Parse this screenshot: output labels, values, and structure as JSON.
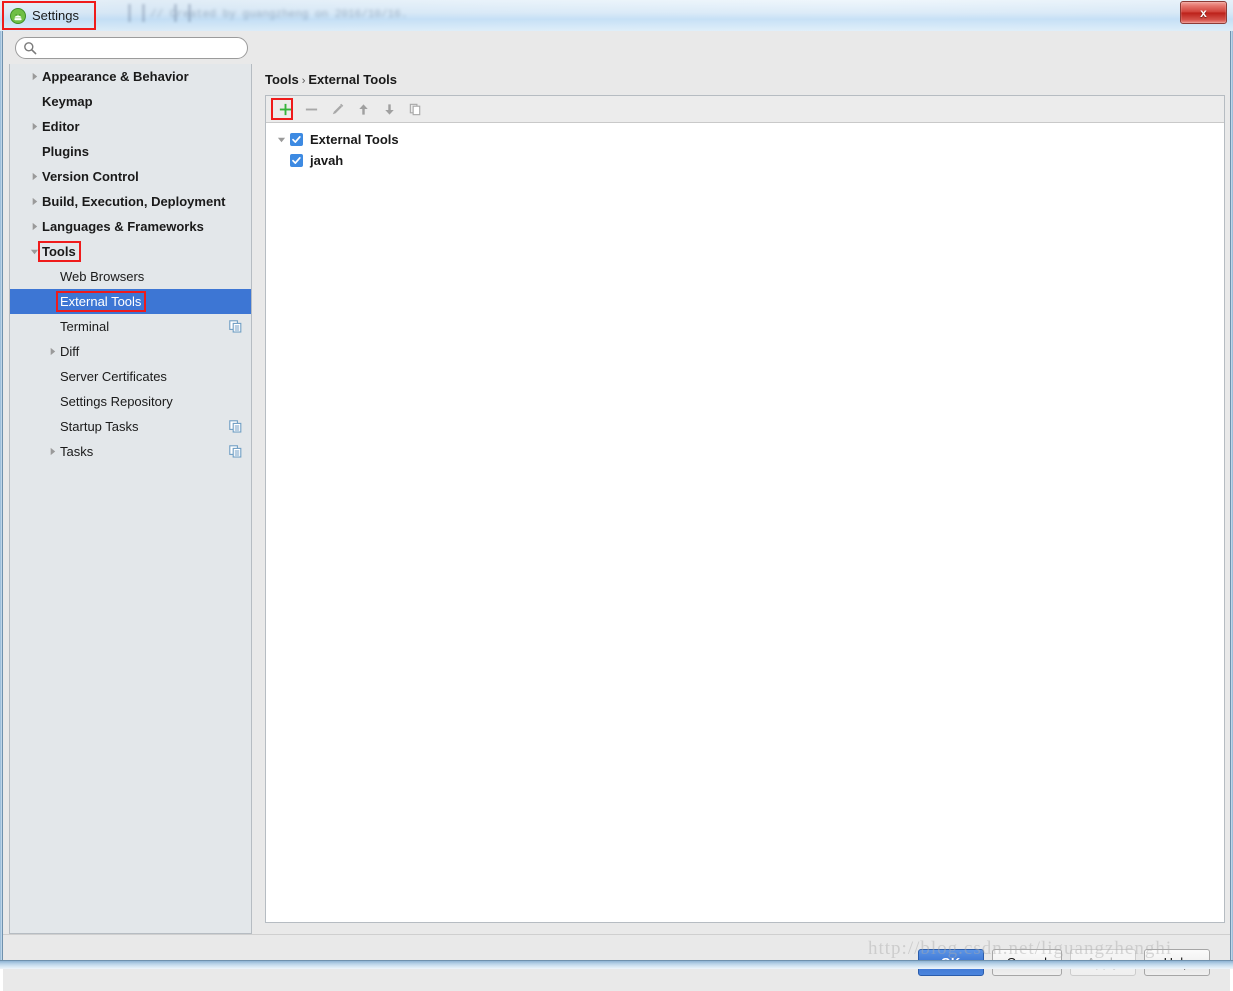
{
  "window": {
    "title": "Settings",
    "title_icon": "android-settings-icon",
    "close_label": "x",
    "glass_ghost_text": "// Created by guangzheng on 2016/10/16."
  },
  "search": {
    "value": "",
    "placeholder": "",
    "icon": "search-icon"
  },
  "sidebar": {
    "items": [
      {
        "label": "Appearance & Behavior",
        "level": "top",
        "arrow": "collapsed",
        "badge": false
      },
      {
        "label": "Keymap",
        "level": "top",
        "arrow": "none",
        "badge": false
      },
      {
        "label": "Editor",
        "level": "top",
        "arrow": "collapsed",
        "badge": false
      },
      {
        "label": "Plugins",
        "level": "top",
        "arrow": "none",
        "badge": false
      },
      {
        "label": "Version Control",
        "level": "top",
        "arrow": "collapsed",
        "badge": false
      },
      {
        "label": "Build, Execution, Deployment",
        "level": "top",
        "arrow": "collapsed",
        "badge": false
      },
      {
        "label": "Languages & Frameworks",
        "level": "top",
        "arrow": "collapsed",
        "badge": false
      },
      {
        "label": "Tools",
        "level": "top",
        "arrow": "expanded",
        "badge": false,
        "highlighted": true
      },
      {
        "label": "Web Browsers",
        "level": "child",
        "arrow": "none",
        "badge": false
      },
      {
        "label": "External Tools",
        "level": "child",
        "arrow": "none",
        "badge": false,
        "selected": true,
        "highlighted": true
      },
      {
        "label": "Terminal",
        "level": "child",
        "arrow": "none",
        "badge": true
      },
      {
        "label": "Diff",
        "level": "child",
        "arrow": "collapsed",
        "badge": false
      },
      {
        "label": "Server Certificates",
        "level": "child",
        "arrow": "none",
        "badge": false
      },
      {
        "label": "Settings Repository",
        "level": "child",
        "arrow": "none",
        "badge": false
      },
      {
        "label": "Startup Tasks",
        "level": "child",
        "arrow": "none",
        "badge": true
      },
      {
        "label": "Tasks",
        "level": "child",
        "arrow": "collapsed",
        "badge": true
      }
    ]
  },
  "content": {
    "breadcrumb": {
      "parent": "Tools",
      "separator": "›",
      "current": "External Tools"
    },
    "toolbar": [
      {
        "name": "add-button",
        "icon": "plus-icon",
        "enabled": true,
        "highlighted": true
      },
      {
        "name": "remove-button",
        "icon": "minus-icon",
        "enabled": false
      },
      {
        "name": "edit-button",
        "icon": "pencil-icon",
        "enabled": false
      },
      {
        "name": "move-up-button",
        "icon": "arrow-up-icon",
        "enabled": false
      },
      {
        "name": "move-down-button",
        "icon": "arrow-down-icon",
        "enabled": false
      },
      {
        "name": "copy-button",
        "icon": "copy-icon",
        "enabled": false
      }
    ],
    "tree": {
      "root": {
        "label": "External Tools",
        "checked": true,
        "expanded": true
      },
      "children": [
        {
          "label": "javah",
          "checked": true
        }
      ]
    }
  },
  "footer": {
    "buttons": [
      {
        "label": "OK",
        "style": "primary",
        "enabled": true
      },
      {
        "label": "Cancel",
        "style": "normal",
        "enabled": true
      },
      {
        "label": "Apply",
        "style": "disabled",
        "enabled": false
      },
      {
        "label": "Help",
        "style": "normal",
        "enabled": true
      }
    ]
  },
  "watermark": {
    "text": "http://blog.csdn.net/liguangzhenghi"
  },
  "colors": {
    "selection_blue": "#3d76d4",
    "annotation_red": "#ef1b1b",
    "checkbox_blue": "#3d8ae2",
    "plus_green": "#36b33b",
    "sidebar_bg": "#e3e7ea",
    "panel_bg": "#ffffff",
    "footer_bg": "#e9e9e9"
  }
}
